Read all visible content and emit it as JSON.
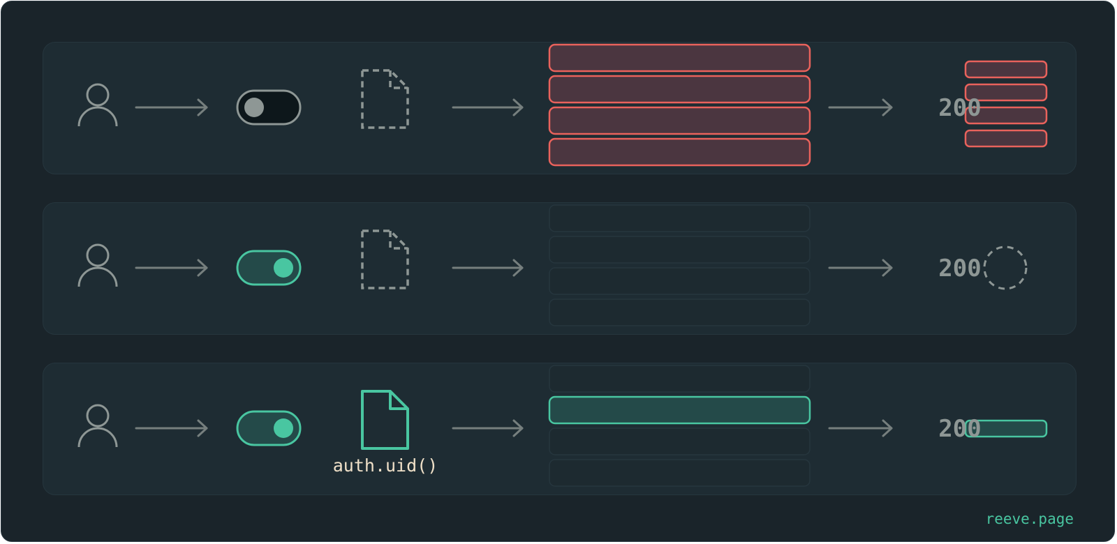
{
  "colors": {
    "background": "#1a242a",
    "row_panel": "#1e2c33",
    "muted_stroke": "#8e9795",
    "danger": "#e9625c",
    "danger_fill": "#4b3640",
    "accent": "#49c6a1",
    "accent_fill": "#244a49",
    "caption": "#efe0c8"
  },
  "rows": [
    {
      "user_icon": "user-icon",
      "toggle_state": "off",
      "document_state": "missing",
      "table_rows": [
        "danger",
        "danger",
        "danger",
        "danger"
      ],
      "status_code": "200",
      "result": "four-rows"
    },
    {
      "user_icon": "user-icon",
      "toggle_state": "on",
      "document_state": "missing",
      "table_rows": [
        "empty",
        "empty",
        "empty",
        "empty"
      ],
      "status_code": "200",
      "result": "empty"
    },
    {
      "user_icon": "user-icon",
      "toggle_state": "on",
      "document_state": "present",
      "document_caption": "auth.uid()",
      "table_rows": [
        "empty",
        "match",
        "empty",
        "empty"
      ],
      "status_code": "200",
      "result": "one-row"
    }
  ],
  "footer": {
    "brand": "reeve.page"
  }
}
